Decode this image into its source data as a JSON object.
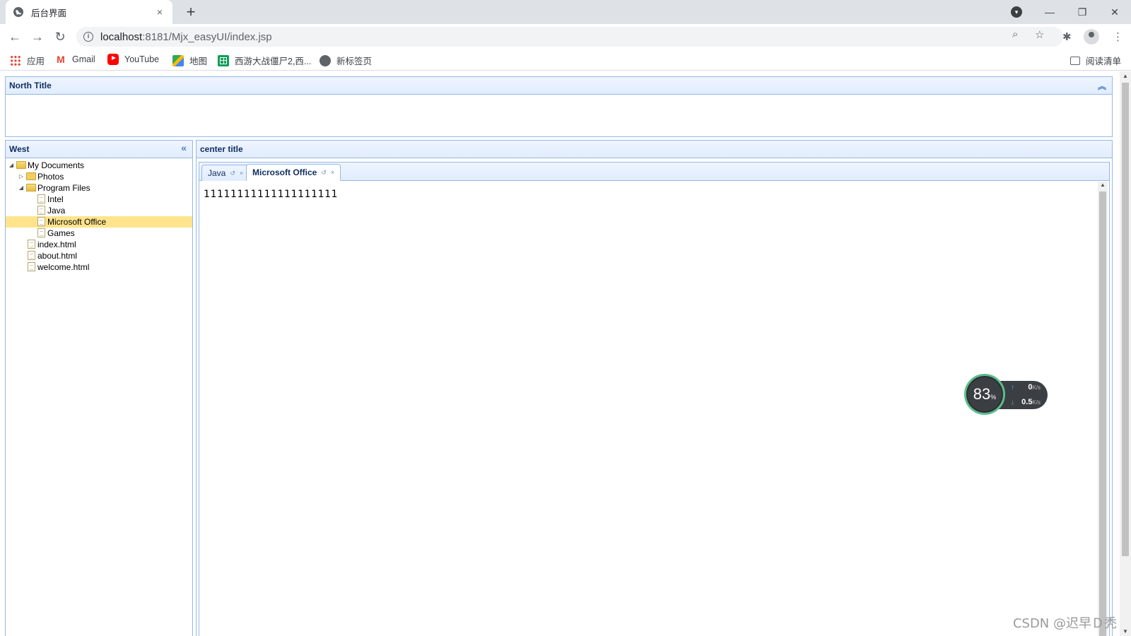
{
  "browser": {
    "tab_title": "后台界面",
    "tab_close": "×",
    "new_tab": "+",
    "url_host": "localhost",
    "url_path": ":8181/Mjx_easyUI/index.jsp",
    "window_controls": {
      "minimize": "—",
      "maximize": "❐",
      "close": "✕"
    }
  },
  "bookmarks": [
    {
      "label": "应用",
      "icon": "apps-icon"
    },
    {
      "label": "Gmail",
      "icon": "gmail-icon"
    },
    {
      "label": "YouTube",
      "icon": "youtube-icon"
    },
    {
      "label": "地图",
      "icon": "maps-icon"
    },
    {
      "label": "西游大战僵尸2,西...",
      "icon": "sheet-icon"
    },
    {
      "label": "新标签页",
      "icon": "globe-icon"
    }
  ],
  "reading_list": "阅读清单",
  "layout": {
    "north_title": "North Title",
    "west_title": "West",
    "center_title": "center title",
    "collapse_up": "︽",
    "collapse_left": "«"
  },
  "tree": {
    "my_documents": "My Documents",
    "photos": "Photos",
    "program_files": "Program Files",
    "intel": "Intel",
    "java": "Java",
    "microsoft_office": "Microsoft Office",
    "games": "Games",
    "index_html": "index.html",
    "about_html": "about.html",
    "welcome_html": "welcome.html"
  },
  "tabs": [
    {
      "label": "Java",
      "refresh": "↺",
      "close": "×",
      "active": false
    },
    {
      "label": "Microsoft Office",
      "refresh": "↺",
      "close": "×",
      "active": true
    }
  ],
  "tab_content": "11111111111111111111",
  "speed_widget": {
    "percent": "83",
    "percent_unit": "%",
    "upload_value": "0",
    "upload_unit": "K/s",
    "download_value": "0.5",
    "download_unit": "K/s"
  },
  "watermark": "CSDN @迟早Ｄ秃"
}
